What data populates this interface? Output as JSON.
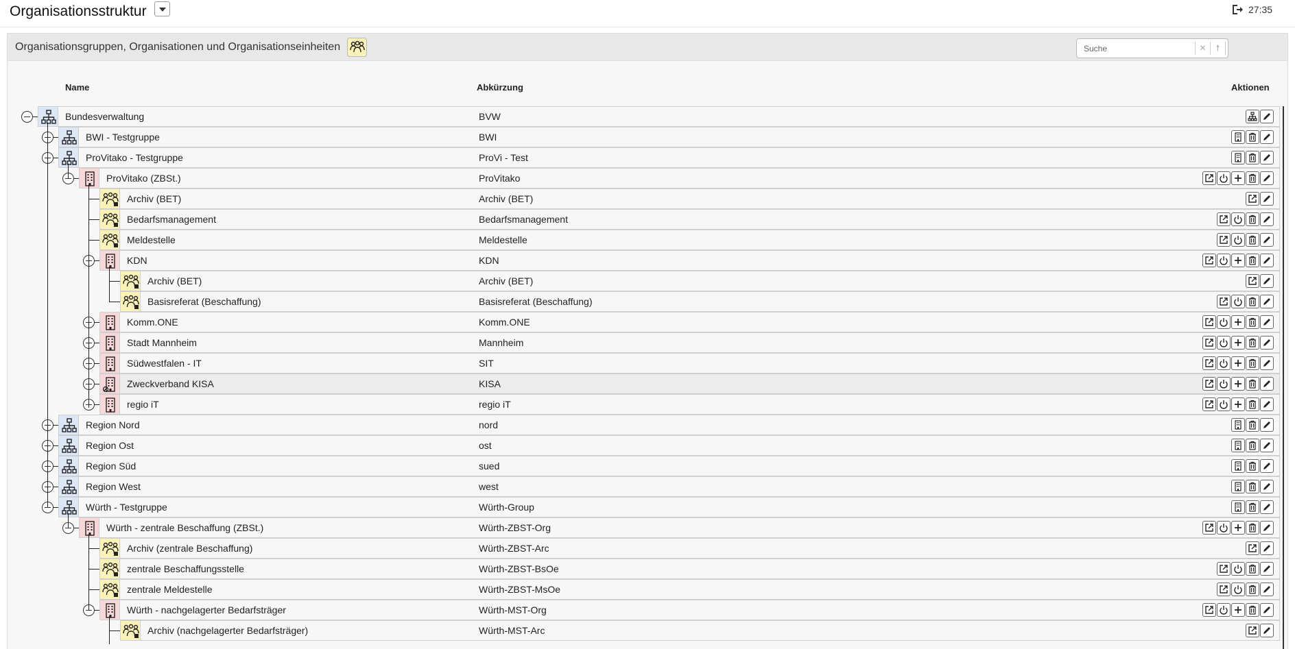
{
  "header": {
    "title": "Organisationsstruktur",
    "time": "27:35"
  },
  "panel": {
    "title": "Organisationsgruppen, Organisationen und Organisationseinheiten"
  },
  "search": {
    "placeholder": "Suche",
    "clear_label": "✕",
    "up_label": "🠕",
    "down_label": "🠗"
  },
  "columns": {
    "name": "Name",
    "abbr": "Abkürzung",
    "actions": "Aktionen"
  },
  "icons": {
    "group": "org-group-icon",
    "org": "building-icon",
    "unit": "users-icon"
  },
  "rows": [
    {
      "name": "Bundesverwaltung",
      "abbr": "BVW",
      "level": 0,
      "type": "group",
      "toggle": "minus",
      "actions": [
        "hierarchy",
        "edit"
      ]
    },
    {
      "name": "BWI - Testgruppe",
      "abbr": "BWI",
      "level": 1,
      "type": "group",
      "toggle": "plus",
      "actions": [
        "building",
        "delete",
        "edit"
      ]
    },
    {
      "name": "ProVitako - Testgruppe",
      "abbr": "ProVi - Test",
      "level": 1,
      "type": "group",
      "toggle": "minus",
      "actions": [
        "building",
        "delete",
        "edit"
      ]
    },
    {
      "name": "ProVitako (ZBSt.)",
      "abbr": "ProVitako",
      "level": 2,
      "type": "org",
      "toggle": "minus",
      "actions": [
        "open",
        "power",
        "add",
        "delete",
        "edit"
      ]
    },
    {
      "name": "Archiv (BET)",
      "abbr": "Archiv (BET)",
      "level": 3,
      "type": "unit",
      "toggle": null,
      "actions": [
        "open",
        "edit"
      ]
    },
    {
      "name": "Bedarfsmanagement",
      "abbr": "Bedarfsmanagement",
      "level": 3,
      "type": "unit",
      "toggle": null,
      "actions": [
        "open",
        "power",
        "delete",
        "edit"
      ]
    },
    {
      "name": "Meldestelle",
      "abbr": "Meldestelle",
      "level": 3,
      "type": "unit",
      "toggle": null,
      "actions": [
        "open",
        "power",
        "delete",
        "edit"
      ]
    },
    {
      "name": "KDN",
      "abbr": "KDN",
      "level": 3,
      "type": "org",
      "toggle": "minus",
      "actions": [
        "open",
        "power",
        "add",
        "delete",
        "edit"
      ]
    },
    {
      "name": "Archiv (BET)",
      "abbr": "Archiv (BET)",
      "level": 4,
      "type": "unit",
      "toggle": null,
      "actions": [
        "open",
        "edit"
      ]
    },
    {
      "name": "Basisreferat (Beschaffung)",
      "abbr": "Basisreferat (Beschaffung)",
      "level": 4,
      "type": "unit",
      "toggle": null,
      "actions": [
        "open",
        "power",
        "delete",
        "edit"
      ]
    },
    {
      "name": "Komm.ONE",
      "abbr": "Komm.ONE",
      "level": 3,
      "type": "org",
      "toggle": "plus",
      "actions": [
        "open",
        "power",
        "add",
        "delete",
        "edit"
      ]
    },
    {
      "name": "Stadt Mannheim",
      "abbr": "Mannheim",
      "level": 3,
      "type": "org",
      "toggle": "plus",
      "actions": [
        "open",
        "power",
        "add",
        "delete",
        "edit"
      ]
    },
    {
      "name": "Südwestfalen - IT",
      "abbr": "SIT",
      "level": 3,
      "type": "org",
      "toggle": "plus",
      "actions": [
        "open",
        "power",
        "add",
        "delete",
        "edit"
      ]
    },
    {
      "name": "Zweckverband KISA",
      "abbr": "KISA",
      "level": 3,
      "type": "org",
      "toggle": "plus",
      "actions": [
        "open",
        "power",
        "add",
        "delete",
        "edit"
      ],
      "highlight": true,
      "locked": true
    },
    {
      "name": "regio iT",
      "abbr": "regio iT",
      "level": 3,
      "type": "org",
      "toggle": "plus",
      "actions": [
        "open",
        "power",
        "add",
        "delete",
        "edit"
      ]
    },
    {
      "name": "Region Nord",
      "abbr": "nord",
      "level": 1,
      "type": "group",
      "toggle": "plus",
      "actions": [
        "building",
        "delete",
        "edit"
      ]
    },
    {
      "name": "Region Ost",
      "abbr": "ost",
      "level": 1,
      "type": "group",
      "toggle": "plus",
      "actions": [
        "building",
        "delete",
        "edit"
      ]
    },
    {
      "name": "Region Süd",
      "abbr": "sued",
      "level": 1,
      "type": "group",
      "toggle": "plus",
      "actions": [
        "building",
        "delete",
        "edit"
      ]
    },
    {
      "name": "Region West",
      "abbr": "west",
      "level": 1,
      "type": "group",
      "toggle": "plus",
      "actions": [
        "building",
        "delete",
        "edit"
      ]
    },
    {
      "name": "Würth - Testgruppe",
      "abbr": "Würth-Group",
      "level": 1,
      "type": "group",
      "toggle": "minus",
      "actions": [
        "building",
        "delete",
        "edit"
      ]
    },
    {
      "name": "Würth - zentrale Beschaffung (ZBSt.)",
      "abbr": "Würth-ZBST-Org",
      "level": 2,
      "type": "org",
      "toggle": "minus",
      "actions": [
        "open",
        "power",
        "add",
        "delete",
        "edit"
      ]
    },
    {
      "name": "Archiv (zentrale Beschaffung)",
      "abbr": "Würth-ZBST-Arc",
      "level": 3,
      "type": "unit",
      "toggle": null,
      "actions": [
        "open",
        "edit"
      ]
    },
    {
      "name": "zentrale Beschaffungsstelle",
      "abbr": "Würth-ZBST-BsOe",
      "level": 3,
      "type": "unit",
      "toggle": null,
      "actions": [
        "open",
        "power",
        "delete",
        "edit"
      ]
    },
    {
      "name": "zentrale Meldestelle",
      "abbr": "Würth-ZBST-MsOe",
      "level": 3,
      "type": "unit",
      "toggle": null,
      "actions": [
        "open",
        "power",
        "delete",
        "edit"
      ]
    },
    {
      "name": "Würth - nachgelagerter Bedarfsträger",
      "abbr": "Würth-MST-Org",
      "level": 3,
      "type": "org",
      "toggle": "minus",
      "actions": [
        "open",
        "power",
        "add",
        "delete",
        "edit"
      ]
    },
    {
      "name": "Archiv (nachgelagerter Bedarfsträger)",
      "abbr": "Würth-MST-Arc",
      "level": 4,
      "type": "unit",
      "toggle": null,
      "actions": [
        "open",
        "edit"
      ]
    }
  ]
}
